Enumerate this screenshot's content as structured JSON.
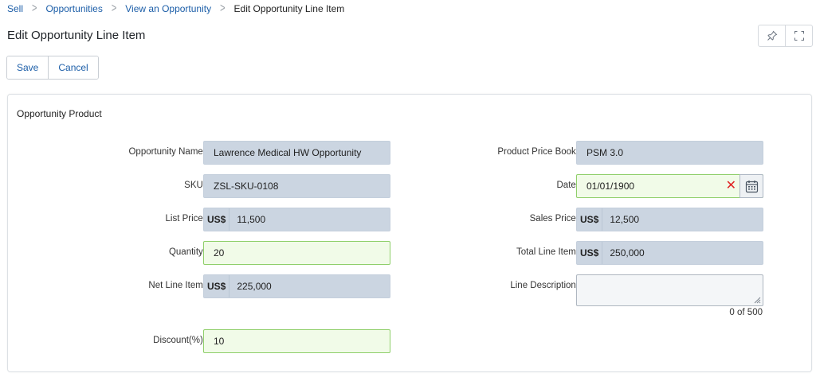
{
  "breadcrumb": {
    "items": [
      "Sell",
      "Opportunities",
      "View an Opportunity"
    ],
    "current": "Edit Opportunity Line Item"
  },
  "page": {
    "title": "Edit Opportunity Line Item"
  },
  "window_buttons": [
    "pin-icon",
    "expand-icon"
  ],
  "toolbar": {
    "save_label": "Save",
    "cancel_label": "Cancel"
  },
  "panel": {
    "title": "Opportunity Product",
    "fields": {
      "opportunity_name": {
        "label": "Opportunity Name:",
        "value": "Lawrence Medical HW Opportunity"
      },
      "sku": {
        "label": "SKU:",
        "value": "ZSL-SKU-0108"
      },
      "list_price": {
        "label": "List Price:",
        "currency": "US$",
        "value": "11,500"
      },
      "quantity": {
        "label": "Quantity:",
        "value": "20"
      },
      "net_line_item": {
        "label": "Net Line Item:",
        "currency": "US$",
        "value": "225,000"
      },
      "discount": {
        "label": "Discount(%):",
        "value": "10"
      },
      "product_price_book": {
        "label": "Product Price Book:",
        "value": "PSM 3.0"
      },
      "date": {
        "label": "Date:",
        "value": "01/01/1900",
        "clear_symbol": "✕"
      },
      "sales_price": {
        "label": "Sales Price:",
        "currency": "US$",
        "value": "12,500"
      },
      "total_line_item": {
        "label": "Total Line Item:",
        "currency": "US$",
        "value": "250,000"
      },
      "line_description": {
        "label": "Line Description:",
        "value": "",
        "counter": "0 of 500"
      }
    }
  },
  "colors": {
    "link": "#1c5ea8",
    "readonly_bg": "#cbd5e1",
    "editable_bg": "#f1fbe8",
    "editable_border": "#8fcf6a",
    "clear": "#e02424"
  }
}
